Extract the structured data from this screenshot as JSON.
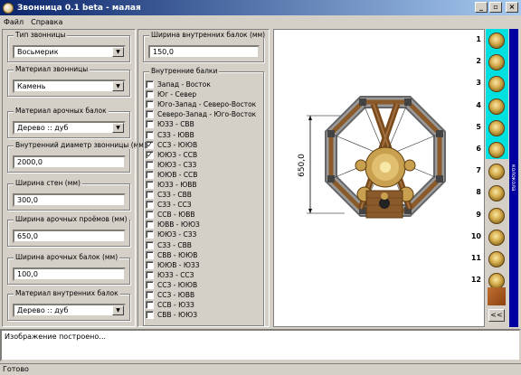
{
  "window": {
    "title": "Звонница 0.1 beta - малая",
    "btn_min": "_",
    "btn_max": "▫",
    "btn_close": "×"
  },
  "menu": {
    "file": "Файл",
    "help": "Справка"
  },
  "left": {
    "belfry_type": {
      "label": "Тип звонницы",
      "value": "Восьмерик"
    },
    "belfry_material": {
      "label": "Материал звонницы",
      "value": "Камень"
    },
    "arch_beam_material": {
      "label": "Материал арочных балок",
      "value": "Дерево :: дуб"
    },
    "inner_diameter": {
      "label": "Внутренний диаметр звонницы (мм)",
      "value": "2000,0"
    },
    "wall_width": {
      "label": "Ширина стен (мм)",
      "value": "300,0"
    },
    "arch_opening_width": {
      "label": "Ширина арочных проёмов (мм)",
      "value": "650,0"
    },
    "arch_beam_width": {
      "label": "Ширина арочных балок (мм)",
      "value": "100,0"
    },
    "inner_beam_material": {
      "label": "Материал внутренних балок",
      "value": "Дерево :: дуб"
    }
  },
  "middle": {
    "inner_beam_width": {
      "label": "Ширина внутренних балок (мм)",
      "value": "150,0"
    },
    "inner_beams": {
      "label": "Внутренние балки",
      "items": [
        {
          "label": "Запад - Восток",
          "checked": false
        },
        {
          "label": "Юг - Север",
          "checked": false
        },
        {
          "label": "Юго-Запад - Северо-Восток",
          "checked": false
        },
        {
          "label": "Северо-Запад - Юго-Восток",
          "checked": false
        },
        {
          "label": "ЮЗЗ - СВВ",
          "checked": false
        },
        {
          "label": "СЗЗ - ЮВВ",
          "checked": false
        },
        {
          "label": "ССЗ - ЮЮВ",
          "checked": true
        },
        {
          "label": "ЮЮЗ - ССВ",
          "checked": true
        },
        {
          "label": "ЮЮЗ - СЗЗ",
          "checked": false
        },
        {
          "label": "ЮЮВ - ССВ",
          "checked": false
        },
        {
          "label": "ЮЗЗ - ЮВВ",
          "checked": false
        },
        {
          "label": "СЗЗ - СВВ",
          "checked": false
        },
        {
          "label": "СЗЗ - ССЗ",
          "checked": false
        },
        {
          "label": "ССВ - ЮВВ",
          "checked": false
        },
        {
          "label": "ЮВВ - ЮЮЗ",
          "checked": false
        },
        {
          "label": "ЮЮЗ - СЗЗ",
          "checked": false
        },
        {
          "label": "СЗЗ - СВВ",
          "checked": false
        },
        {
          "label": "СВВ - ЮЮВ",
          "checked": false
        },
        {
          "label": "ЮЮВ - ЮЗЗ",
          "checked": false
        },
        {
          "label": "ЮЗЗ - ССЗ",
          "checked": false
        },
        {
          "label": "ССЗ - ЮЮВ",
          "checked": false
        },
        {
          "label": "ССЗ - ЮВВ",
          "checked": false
        },
        {
          "label": "ССВ - ЮЗЗ",
          "checked": false
        },
        {
          "label": "СВВ - ЮЮЗ",
          "checked": false
        }
      ]
    }
  },
  "drawing": {
    "dimension_label": "650,0"
  },
  "bells": [
    "1",
    "2",
    "3",
    "4",
    "5",
    "6",
    "7",
    "8",
    "9",
    "10",
    "11",
    "12"
  ],
  "side_tab": "колокола",
  "back_button": "<<",
  "log": "Изображение построено...",
  "status": "Готово",
  "colors": {
    "title_start": "#0a246a",
    "title_end": "#a6caf0",
    "cyan": "#00e0e0",
    "side_blue": "#0000a0"
  }
}
